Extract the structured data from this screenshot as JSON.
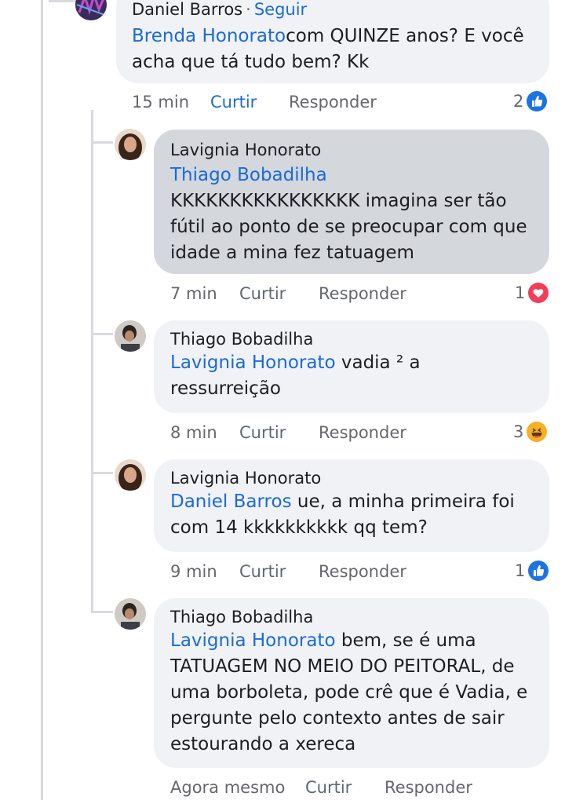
{
  "comments": [
    {
      "author": "Daniel Barros",
      "follow_label": "Seguir",
      "mention": "Brenda Honorato",
      "text": "com QUINZE anos? E você acha que tá tudo bem? Kk",
      "time": "15 min",
      "like_label": "Curtir",
      "reply_label": "Responder",
      "reaction_count": "2",
      "reaction_icon": "like-icon"
    },
    {
      "author": "Lavignia Honorato",
      "mention": "Thiago Bobadilha",
      "text": "KKKKKKKKKKKKKKKK imagina ser tão fútil ao ponto de se preocupar com que idade a mina fez tatuagem",
      "time": "7 min",
      "like_label": "Curtir",
      "reply_label": "Responder",
      "reaction_count": "1",
      "reaction_icon": "love-icon"
    },
    {
      "author": "Thiago Bobadilha",
      "mention": "Lavignia Honorato",
      "text": " vadia ² a ressurreição",
      "time": "8 min",
      "like_label": "Curtir",
      "reply_label": "Responder",
      "reaction_count": "3",
      "reaction_icon": "haha-icon"
    },
    {
      "author": "Lavignia Honorato",
      "mention": "Daniel Barros",
      "text": " ue, a minha primeira foi com 14 kkkkkkkkkk qq tem?",
      "time": "9 min",
      "like_label": "Curtir",
      "reply_label": "Responder",
      "reaction_count": "1",
      "reaction_icon": "like-icon"
    },
    {
      "author": "Thiago Bobadilha",
      "mention": "Lavignia Honorato",
      "text": " bem, se é uma TATUAGEM NO MEIO DO PEITORAL, de uma borboleta, pode crê que é Vadia, e pergunte pelo contexto antes de sair estourando a xereca",
      "time": "Agora mesmo",
      "like_label": "Curtir",
      "reply_label": "Responder"
    }
  ],
  "colors": {
    "link_blue": "#1b6ad8",
    "bubble_gray": "#f0f2f5",
    "bubble_selected": "#d4d7dc",
    "meta_gray": "#65676b"
  }
}
